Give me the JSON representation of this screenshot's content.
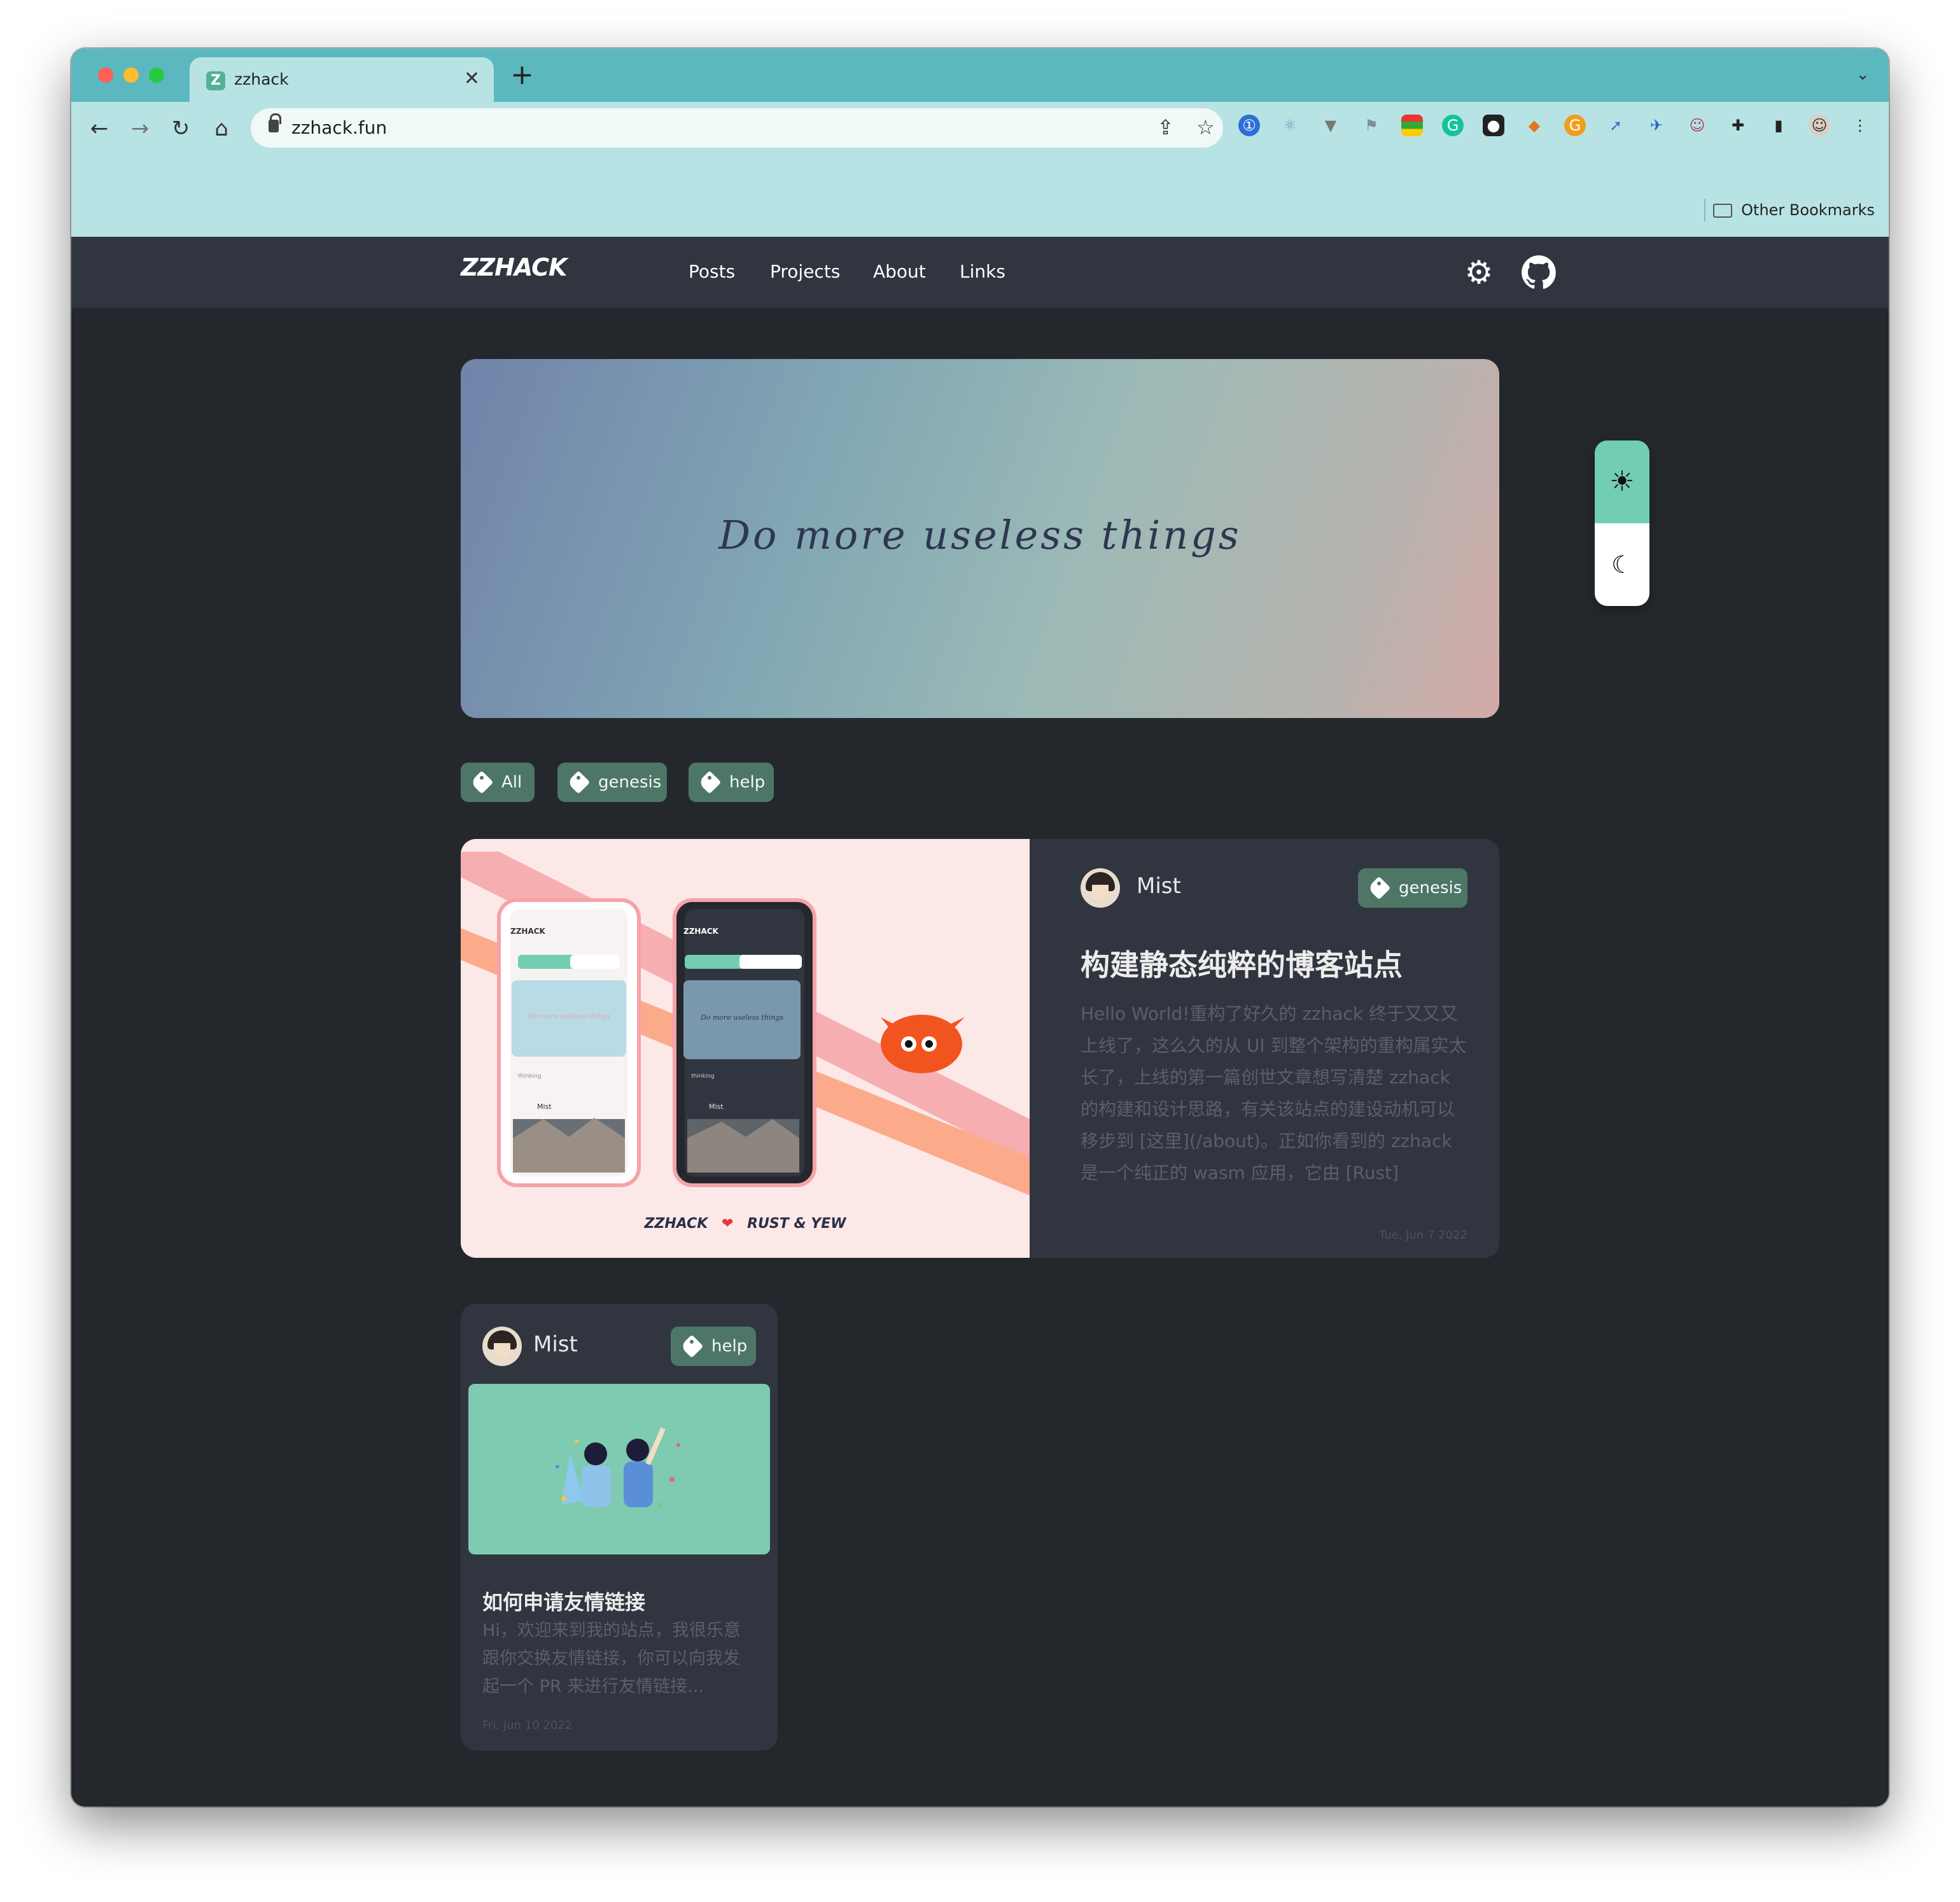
{
  "browser": {
    "tab_title": "zzhack",
    "tab_favicon": "Z",
    "url": "zzhack.fun",
    "other_bookmarks": "Other Bookmarks",
    "accent": "#5cb8bf",
    "toolbar_color": "#b8e3e5"
  },
  "site": {
    "logo": "ZZHACK",
    "nav": [
      "Posts",
      "Projects",
      "About",
      "Links"
    ],
    "hero_text": "Do more useless things",
    "tags": [
      "All",
      "genesis",
      "help"
    ],
    "tag_color": "#4d7667",
    "theme_toggle": {
      "light_icon": "sun-icon",
      "dark_icon": "moon-icon",
      "active": "dark"
    }
  },
  "posts": [
    {
      "author": "Mist",
      "tag": "genesis",
      "title": "构建静态纯粹的博客站点",
      "excerpt": "Hello World!重构了好久的 zzhack 终于又又又上线了，这么久的从 UI 到整个架构的重构属实太长了，上线的第一篇创世文章想写清楚 zzhack 的构建和设计思路，有关该站点的建设动机可以移步到 [这里](/about)。正如你看到的 zzhack 是一个纯正的 wasm 应用，它由 [Rust](https:/...",
      "date": "Tue, Jun 7 2022",
      "cover_caption_left": "ZZHACK",
      "cover_caption_right": "RUST & YEW",
      "cover_mock_logo": "ZZHACK",
      "cover_mock_hero": "Do more useless things",
      "cover_mock_tag": "thinking",
      "cover_mock_author": "Mist"
    },
    {
      "author": "Mist",
      "tag": "help",
      "title": "如何申请友情链接",
      "excerpt": "Hi，欢迎来到我的站点，我很乐意跟你交换友情链接，你可以向我发起一个 PR 来进行友情链接...",
      "date": "Fri, Jun 10 2022"
    }
  ]
}
